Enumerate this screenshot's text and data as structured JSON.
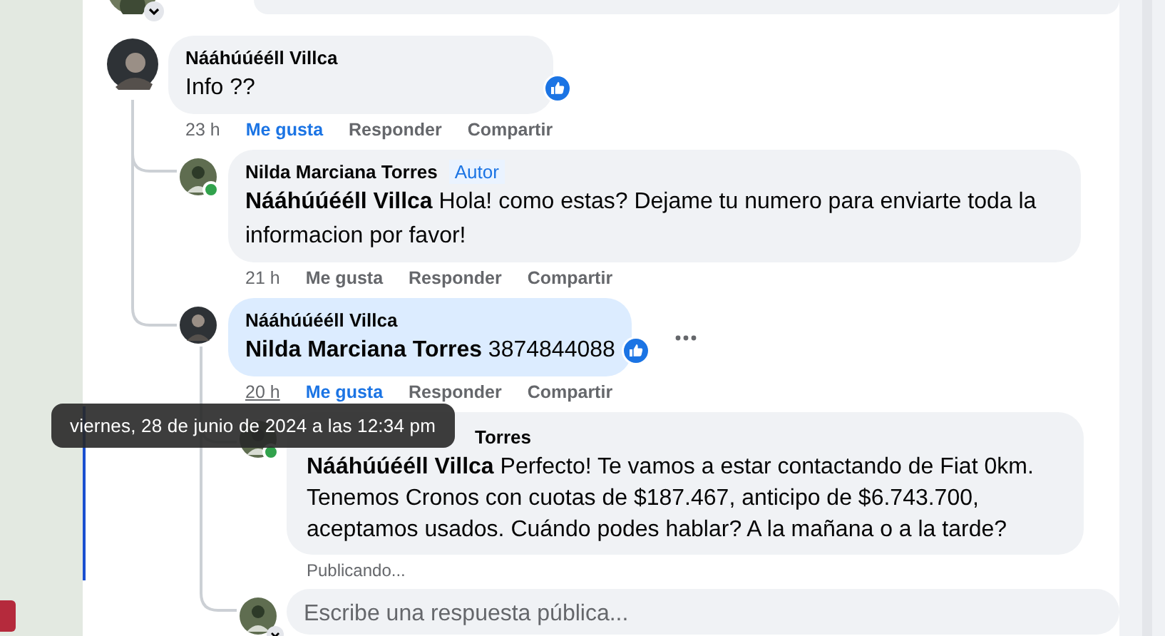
{
  "thread": {
    "author": "Nááhúúééll Villca",
    "text": "Info ??",
    "reacted": true,
    "time": "23 h",
    "time_hovered": false,
    "actions": [
      {
        "label": "Me gusta",
        "selected": true
      },
      {
        "label": "Responder",
        "selected": false
      },
      {
        "label": "Compartir",
        "selected": false
      }
    ],
    "replies": [
      {
        "author": "Nilda Marciana Torres",
        "badge": "Autor",
        "online": true,
        "highlighted": false,
        "text": "**Nááhúúééll Villca** Hola! como estas? Dejame tu numero para enviarte toda la informacion por favor!",
        "time": "21 h",
        "time_hovered": false,
        "actions": [
          {
            "label": "Me gusta",
            "selected": false
          },
          {
            "label": "Responder",
            "selected": false
          },
          {
            "label": "Compartir",
            "selected": false
          }
        ]
      },
      {
        "author": "Nááhúúééll Villca",
        "highlighted": true,
        "text": "**Nilda Marciana Torres** 3874844088",
        "reacted": true,
        "more_menu": true,
        "time": "20 h",
        "time_hovered": true,
        "actions": [
          {
            "label": "Me gusta",
            "selected": true
          },
          {
            "label": "Responder",
            "selected": false
          },
          {
            "label": "Compartir",
            "selected": false
          }
        ]
      }
    ],
    "nested_reply": {
      "author": "Torres",
      "online": true,
      "text": "**Nááhúúééll Villca** Perfecto! Te vamos a estar contactando de Fiat 0km. Tenemos Cronos con cuotas de $187.467, anticipo de $6.743.700, aceptamos usados. Cuándo podes hablar? A la mañana o a la tarde?",
      "status": "Publicando..."
    }
  },
  "tooltip": "viernes, 28 de junio de 2024 a las 12:34 pm",
  "composer": {
    "placeholder": "Escribe una respuesta pública..."
  }
}
